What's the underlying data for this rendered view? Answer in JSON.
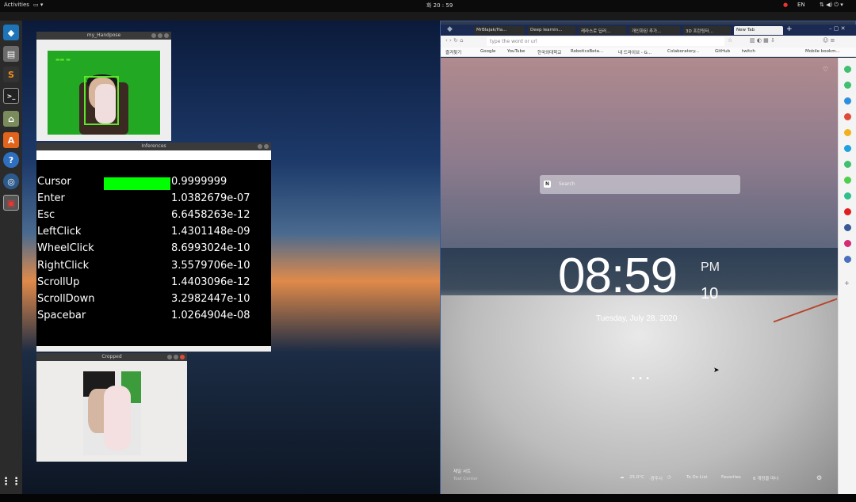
{
  "topbar": {
    "activities": "Activities",
    "clock": "화 20 : 59",
    "lang": "EN",
    "date_stub": "20"
  },
  "windows": {
    "handpose": {
      "title": "my_Handpose"
    },
    "inferences": {
      "title": "Inferences",
      "rows": [
        {
          "label": "Cursor",
          "value": "0.9999999",
          "bar": 0.9999999
        },
        {
          "label": "Enter",
          "value": "1.0382679e-07",
          "bar": 0
        },
        {
          "label": "Esc",
          "value": "6.6458263e-12",
          "bar": 0
        },
        {
          "label": "LeftClick",
          "value": "1.4301148e-09",
          "bar": 0
        },
        {
          "label": "WheelClick",
          "value": "8.6993024e-10",
          "bar": 0
        },
        {
          "label": "RightClick",
          "value": "3.5579706e-10",
          "bar": 0
        },
        {
          "label": "ScrollUp",
          "value": "1.4403096e-12",
          "bar": 0
        },
        {
          "label": "ScrollDown",
          "value": "3.2982447e-10",
          "bar": 0
        },
        {
          "label": "Spacebar",
          "value": "1.0264904e-08",
          "bar": 0
        }
      ],
      "bar_color": "#00ff00"
    },
    "cropped": {
      "title": "Cropped"
    }
  },
  "browser": {
    "tabs": [
      {
        "label": "MrBlajak/Ha..."
      },
      {
        "label": "Deep learnin..."
      },
      {
        "label": "케라스로 딥러..."
      },
      {
        "label": "개인화된 추가..."
      },
      {
        "label": "3D 프린팅터..."
      },
      {
        "label": "New Tab"
      }
    ],
    "url_placeholder": "type the word or url",
    "bookmarks": [
      "즐겨찾기",
      "Google",
      "YouTube",
      "한국외대학교",
      "RoboticsBeta...",
      "내 드라이브 - G...",
      "Colaboratory...",
      "GitHub",
      "twitch",
      "Mobile bookm..."
    ],
    "newtab": {
      "search_placeholder": "Search",
      "search_logo": "N",
      "time": "08:59",
      "ampm": "PM",
      "seconds": "10",
      "date": "Tuesday, July 28, 2020",
      "dots": "• • •",
      "footer_left_top": "제일 서트",
      "footer_left_bottom": "Tool Center",
      "weather": "25.0°C",
      "weather_sub": "·광주시",
      "todo": "To Do List",
      "favorites": "Favorites",
      "unread": "6 개정을 떠나",
      "accent": "#3a5a9a"
    }
  }
}
